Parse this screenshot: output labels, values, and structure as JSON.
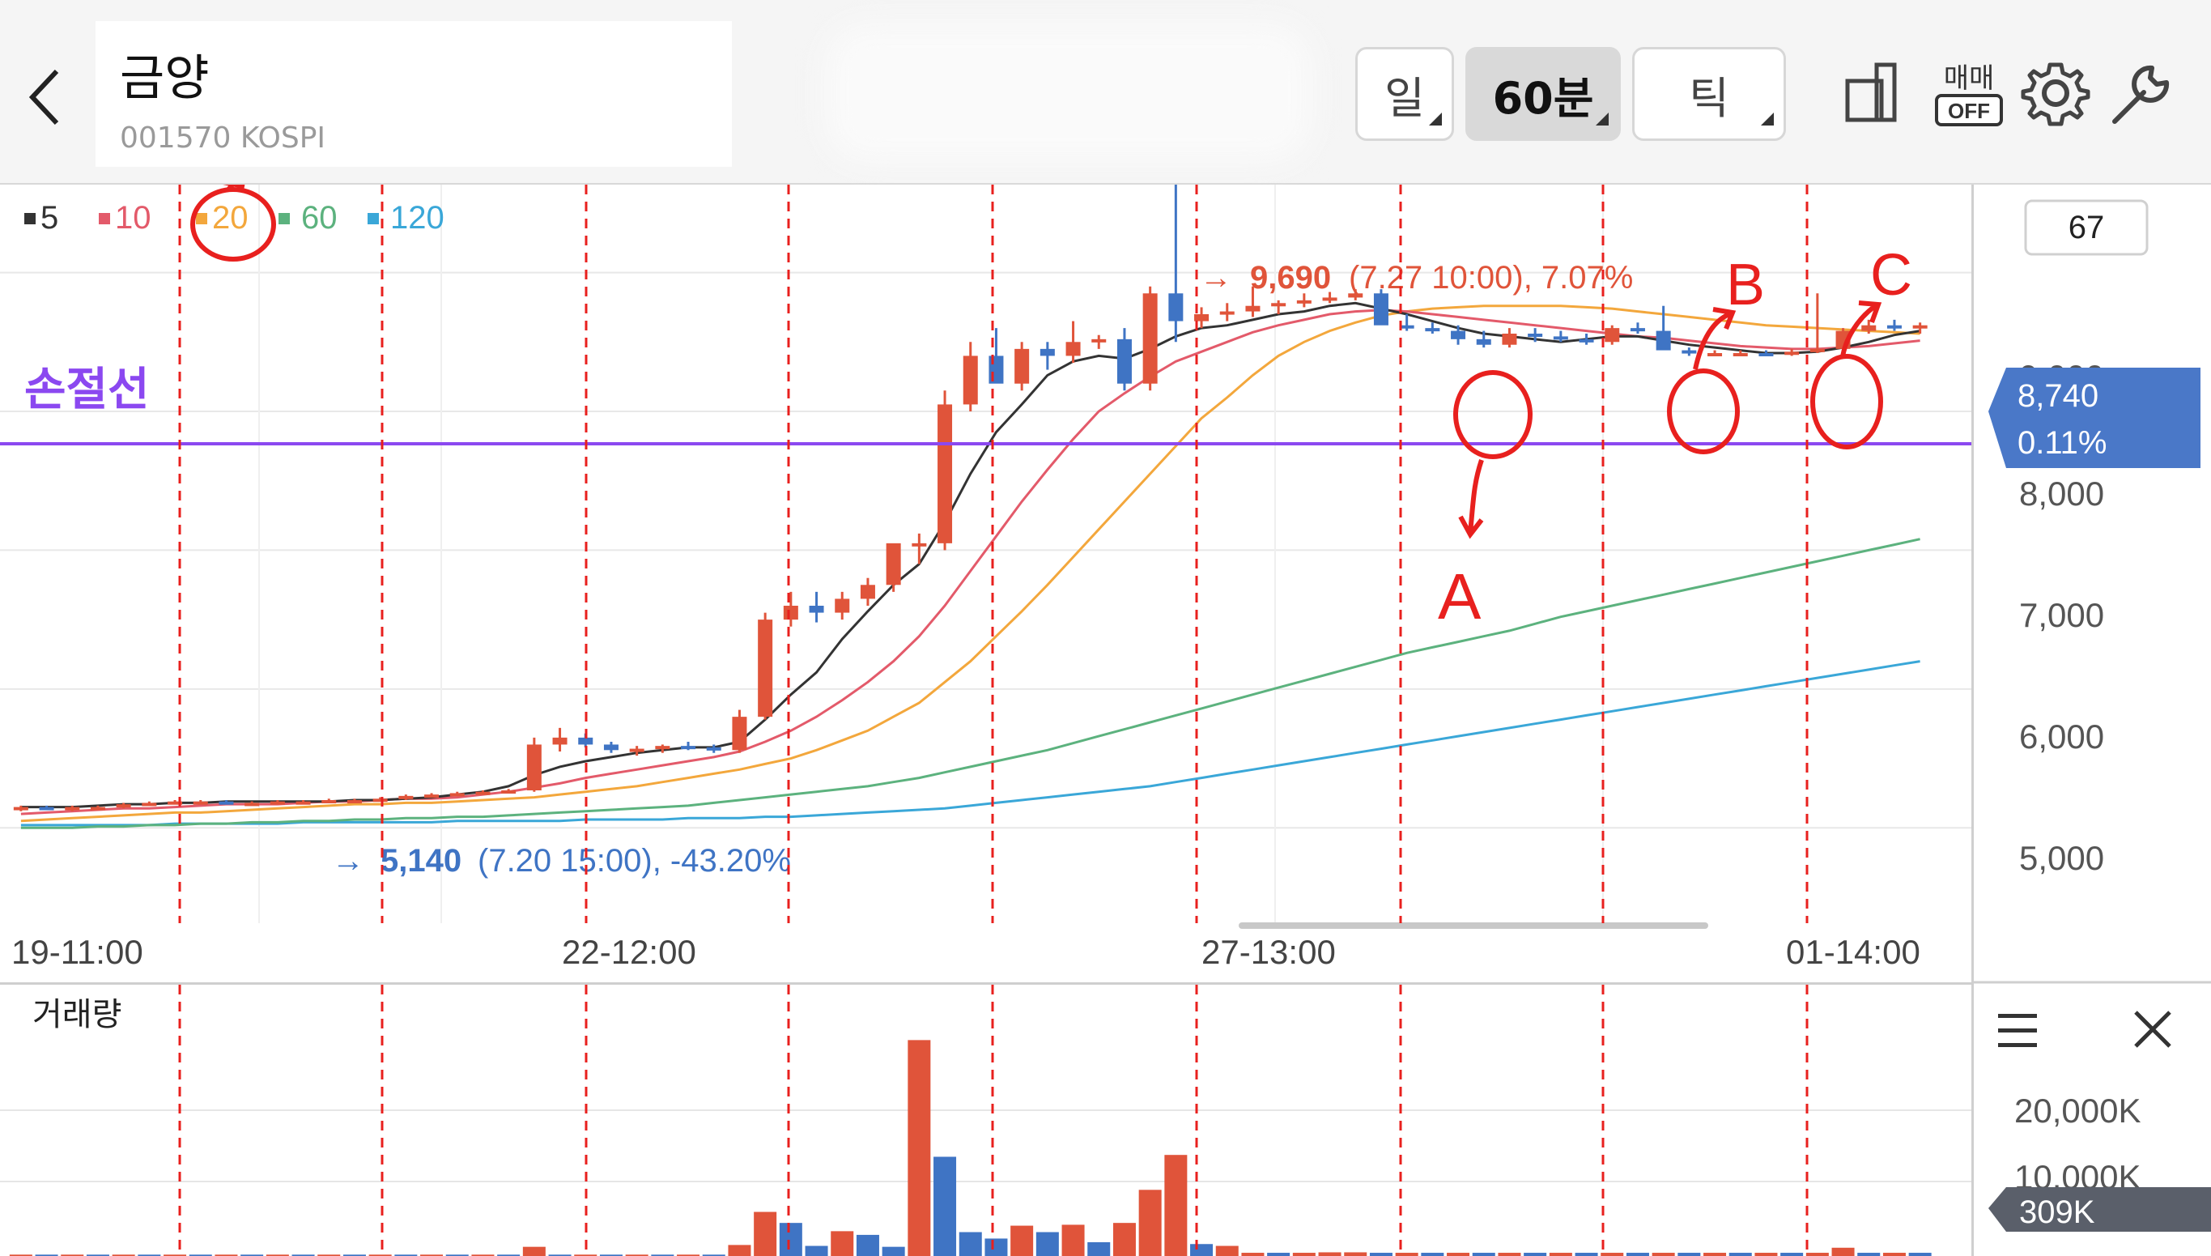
{
  "header": {
    "stock_name": "금양",
    "stock_code": "001570 KOSPI",
    "periods": [
      {
        "label": "일",
        "active": false
      },
      {
        "label": "60분",
        "active": true
      },
      {
        "label": "틱",
        "active": false
      }
    ],
    "trade_toggle_label": "매매",
    "trade_toggle_state": "OFF"
  },
  "legend": [
    {
      "label": "5",
      "color": "#333333"
    },
    {
      "label": "10",
      "color": "#e35a6a"
    },
    {
      "label": "20",
      "color": "#f3a73c"
    },
    {
      "label": "60",
      "color": "#5cb27e"
    },
    {
      "label": "120",
      "color": "#3aa7d8"
    }
  ],
  "annotations": {
    "stop_line_label": "손절선",
    "markers": [
      "A",
      "B",
      "C"
    ]
  },
  "price_high_label": {
    "value": "9,690",
    "detail": "(7.27 10:00), 7.07%"
  },
  "price_low_label": {
    "value": "5,140",
    "detail": "(7.20 15:00), -43.20%"
  },
  "price_axis": {
    "top_box": "67",
    "ticks": [
      "9,000",
      "8,000",
      "7,000",
      "6,000",
      "5,000"
    ],
    "current_price": "8,740",
    "current_change": "0.11%"
  },
  "time_axis": [
    "19-11:00",
    "22-12:00",
    "27-13:00",
    "01-14:00"
  ],
  "volume": {
    "title": "거래량",
    "ticks": [
      "20,000K",
      "10,000K"
    ],
    "current": "309K"
  },
  "colors": {
    "up": "#e0543a",
    "down": "#3f74c4",
    "stop_line": "#8b48f0",
    "annotation": "#e8201e"
  },
  "chart_data": {
    "type": "candlestick",
    "price_ylim": [
      4500,
      9400
    ],
    "candles": [
      [
        5140,
        5160,
        5120,
        5150
      ],
      [
        5150,
        5160,
        5130,
        5140
      ],
      [
        5140,
        5160,
        5120,
        5150
      ],
      [
        5150,
        5160,
        5140,
        5150
      ],
      [
        5150,
        5180,
        5140,
        5170
      ],
      [
        5170,
        5190,
        5160,
        5180
      ],
      [
        5180,
        5200,
        5170,
        5190
      ],
      [
        5190,
        5200,
        5180,
        5190
      ],
      [
        5190,
        5200,
        5170,
        5180
      ],
      [
        5180,
        5190,
        5170,
        5180
      ],
      [
        5180,
        5200,
        5170,
        5190
      ],
      [
        5190,
        5200,
        5180,
        5190
      ],
      [
        5190,
        5210,
        5180,
        5200
      ],
      [
        5200,
        5210,
        5190,
        5200
      ],
      [
        5200,
        5220,
        5190,
        5210
      ],
      [
        5210,
        5240,
        5200,
        5230
      ],
      [
        5230,
        5250,
        5220,
        5240
      ],
      [
        5240,
        5260,
        5230,
        5250
      ],
      [
        5250,
        5270,
        5240,
        5260
      ],
      [
        5260,
        5280,
        5250,
        5270
      ],
      [
        5270,
        5650,
        5260,
        5600
      ],
      [
        5600,
        5720,
        5550,
        5650
      ],
      [
        5650,
        5680,
        5580,
        5600
      ],
      [
        5600,
        5620,
        5540,
        5560
      ],
      [
        5560,
        5590,
        5520,
        5570
      ],
      [
        5570,
        5600,
        5540,
        5590
      ],
      [
        5590,
        5620,
        5560,
        5580
      ],
      [
        5580,
        5600,
        5540,
        5560
      ],
      [
        5560,
        5850,
        5540,
        5800
      ],
      [
        5800,
        6550,
        5780,
        6500
      ],
      [
        6500,
        6700,
        6450,
        6600
      ],
      [
        6600,
        6700,
        6480,
        6550
      ],
      [
        6550,
        6700,
        6500,
        6650
      ],
      [
        6650,
        6800,
        6600,
        6750
      ],
      [
        6750,
        6950,
        6700,
        7050
      ],
      [
        7050,
        7120,
        6900,
        7050
      ],
      [
        7050,
        8150,
        7000,
        8050
      ],
      [
        8050,
        8500,
        8000,
        8400
      ],
      [
        8400,
        8600,
        8300,
        8200
      ],
      [
        8200,
        8500,
        8150,
        8450
      ],
      [
        8450,
        8500,
        8300,
        8400
      ],
      [
        8400,
        8650,
        8350,
        8500
      ],
      [
        8500,
        8550,
        8450,
        8520
      ],
      [
        8520,
        8600,
        8150,
        8200
      ],
      [
        8200,
        8900,
        8150,
        8850
      ],
      [
        8850,
        9690,
        8500,
        8650
      ],
      [
        8650,
        8750,
        8600,
        8700
      ],
      [
        8700,
        8780,
        8650,
        8720
      ],
      [
        8720,
        8900,
        8680,
        8760
      ],
      [
        8760,
        8800,
        8700,
        8780
      ],
      [
        8780,
        8850,
        8750,
        8800
      ],
      [
        8800,
        8860,
        8780,
        8820
      ],
      [
        8820,
        8880,
        8800,
        8850
      ],
      [
        8850,
        8880,
        8780,
        8620
      ],
      [
        8620,
        8700,
        8580,
        8600
      ],
      [
        8600,
        8640,
        8560,
        8580
      ],
      [
        8580,
        8620,
        8480,
        8520
      ],
      [
        8520,
        8580,
        8460,
        8480
      ],
      [
        8480,
        8600,
        8460,
        8560
      ],
      [
        8560,
        8600,
        8500,
        8540
      ],
      [
        8540,
        8580,
        8500,
        8520
      ],
      [
        8520,
        8560,
        8480,
        8500
      ],
      [
        8500,
        8620,
        8480,
        8600
      ],
      [
        8600,
        8640,
        8560,
        8580
      ],
      [
        8580,
        8760,
        8460,
        8440
      ],
      [
        8440,
        8460,
        8400,
        8420
      ],
      [
        8420,
        8440,
        8400,
        8420
      ],
      [
        8420,
        8440,
        8400,
        8420
      ],
      [
        8420,
        8440,
        8400,
        8410
      ],
      [
        8410,
        8450,
        8400,
        8430
      ],
      [
        8430,
        8850,
        8420,
        8450
      ],
      [
        8450,
        8600,
        8440,
        8580
      ],
      [
        8580,
        8660,
        8560,
        8620
      ],
      [
        8620,
        8660,
        8580,
        8600
      ],
      [
        8600,
        8640,
        8560,
        8620
      ]
    ],
    "ma5": [
      5150,
      5150,
      5150,
      5160,
      5170,
      5170,
      5180,
      5180,
      5190,
      5190,
      5190,
      5190,
      5190,
      5200,
      5200,
      5210,
      5220,
      5240,
      5260,
      5300,
      5380,
      5440,
      5480,
      5510,
      5540,
      5560,
      5580,
      5580,
      5620,
      5780,
      5960,
      6120,
      6360,
      6560,
      6750,
      6900,
      7200,
      7550,
      7850,
      8050,
      8260,
      8360,
      8400,
      8380,
      8450,
      8540,
      8600,
      8620,
      8660,
      8700,
      8720,
      8760,
      8780,
      8740,
      8700,
      8650,
      8600,
      8560,
      8540,
      8520,
      8500,
      8520,
      8540,
      8540,
      8510,
      8480,
      8460,
      8440,
      8420,
      8420,
      8430,
      8460,
      8500,
      8550,
      8580
    ],
    "ma10": [
      5100,
      5110,
      5120,
      5130,
      5140,
      5140,
      5150,
      5160,
      5170,
      5170,
      5170,
      5180,
      5190,
      5190,
      5200,
      5210,
      5210,
      5220,
      5240,
      5260,
      5290,
      5320,
      5360,
      5390,
      5420,
      5450,
      5480,
      5510,
      5550,
      5620,
      5700,
      5800,
      5920,
      6050,
      6200,
      6380,
      6600,
      6850,
      7100,
      7350,
      7580,
      7800,
      8000,
      8130,
      8250,
      8360,
      8430,
      8500,
      8570,
      8620,
      8660,
      8700,
      8720,
      8730,
      8720,
      8700,
      8680,
      8660,
      8640,
      8620,
      8600,
      8580,
      8560,
      8540,
      8530,
      8510,
      8490,
      8470,
      8460,
      8450,
      8450,
      8460,
      8470,
      8490,
      8510
    ],
    "ma20": [
      5050,
      5060,
      5070,
      5080,
      5090,
      5100,
      5110,
      5110,
      5120,
      5130,
      5140,
      5150,
      5160,
      5170,
      5170,
      5180,
      5180,
      5190,
      5200,
      5210,
      5220,
      5240,
      5260,
      5280,
      5300,
      5330,
      5360,
      5390,
      5420,
      5460,
      5500,
      5560,
      5630,
      5700,
      5800,
      5900,
      6050,
      6200,
      6380,
      6560,
      6750,
      6950,
      7150,
      7350,
      7550,
      7750,
      7950,
      8100,
      8260,
      8400,
      8500,
      8580,
      8640,
      8690,
      8720,
      8740,
      8750,
      8760,
      8760,
      8760,
      8760,
      8750,
      8740,
      8720,
      8700,
      8680,
      8660,
      8640,
      8620,
      8610,
      8600,
      8590,
      8580,
      8570,
      8560
    ],
    "ma60": [
      5000,
      5000,
      5000,
      5010,
      5010,
      5020,
      5020,
      5030,
      5030,
      5040,
      5040,
      5050,
      5050,
      5060,
      5060,
      5070,
      5070,
      5080,
      5080,
      5090,
      5100,
      5110,
      5120,
      5130,
      5140,
      5150,
      5160,
      5180,
      5200,
      5220,
      5240,
      5260,
      5280,
      5300,
      5330,
      5360,
      5400,
      5440,
      5480,
      5520,
      5560,
      5610,
      5660,
      5710,
      5760,
      5810,
      5860,
      5910,
      5960,
      6010,
      6060,
      6110,
      6160,
      6210,
      6260,
      6300,
      6340,
      6380,
      6420,
      6470,
      6520,
      6560,
      6600,
      6640,
      6680,
      6720,
      6760,
      6800,
      6840,
      6880,
      6920,
      6960,
      7000,
      7040,
      7080
    ],
    "ma120": [
      5020,
      5020,
      5020,
      5020,
      5020,
      5020,
      5030,
      5030,
      5030,
      5030,
      5030,
      5040,
      5040,
      5040,
      5040,
      5040,
      5040,
      5050,
      5050,
      5050,
      5050,
      5050,
      5060,
      5060,
      5060,
      5060,
      5070,
      5070,
      5070,
      5080,
      5080,
      5090,
      5100,
      5110,
      5120,
      5130,
      5140,
      5160,
      5180,
      5200,
      5220,
      5240,
      5260,
      5280,
      5300,
      5330,
      5360,
      5390,
      5420,
      5450,
      5480,
      5510,
      5540,
      5570,
      5600,
      5630,
      5660,
      5690,
      5720,
      5750,
      5780,
      5810,
      5840,
      5870,
      5900,
      5930,
      5960,
      5990,
      6020,
      6050,
      6080,
      6110,
      6140,
      6170,
      6200
    ],
    "volume_ylim": [
      0,
      26000
    ],
    "volume": [
      [
        150,
        0
      ],
      [
        150,
        1
      ],
      [
        150,
        0
      ],
      [
        150,
        1
      ],
      [
        150,
        0
      ],
      [
        150,
        1
      ],
      [
        150,
        0
      ],
      [
        150,
        1
      ],
      [
        150,
        0
      ],
      [
        150,
        1
      ],
      [
        150,
        0
      ],
      [
        150,
        1
      ],
      [
        150,
        0
      ],
      [
        150,
        1
      ],
      [
        150,
        0
      ],
      [
        150,
        1
      ],
      [
        150,
        0
      ],
      [
        150,
        1
      ],
      [
        150,
        0
      ],
      [
        150,
        1
      ],
      [
        1000,
        0
      ],
      [
        150,
        1
      ],
      [
        150,
        0
      ],
      [
        150,
        1
      ],
      [
        150,
        0
      ],
      [
        150,
        1
      ],
      [
        150,
        0
      ],
      [
        150,
        1
      ],
      [
        1200,
        0
      ],
      [
        4800,
        0
      ],
      [
        3600,
        1
      ],
      [
        1100,
        1
      ],
      [
        2700,
        0
      ],
      [
        2300,
        1
      ],
      [
        1000,
        1
      ],
      [
        23500,
        0
      ],
      [
        10800,
        1
      ],
      [
        2600,
        1
      ],
      [
        1900,
        1
      ],
      [
        3300,
        0
      ],
      [
        2600,
        1
      ],
      [
        3400,
        0
      ],
      [
        1500,
        1
      ],
      [
        3600,
        0
      ],
      [
        7200,
        0
      ],
      [
        11000,
        0
      ],
      [
        1300,
        1
      ],
      [
        1100,
        0
      ],
      [
        350,
        0
      ],
      [
        350,
        1
      ],
      [
        350,
        0
      ],
      [
        400,
        0
      ],
      [
        400,
        0
      ],
      [
        350,
        1
      ],
      [
        350,
        0
      ],
      [
        350,
        1
      ],
      [
        350,
        0
      ],
      [
        350,
        1
      ],
      [
        350,
        0
      ],
      [
        350,
        1
      ],
      [
        350,
        0
      ],
      [
        350,
        1
      ],
      [
        350,
        0
      ],
      [
        350,
        1
      ],
      [
        350,
        0
      ],
      [
        350,
        1
      ],
      [
        350,
        0
      ],
      [
        350,
        1
      ],
      [
        350,
        0
      ],
      [
        350,
        1
      ],
      [
        350,
        0
      ],
      [
        900,
        0
      ],
      [
        350,
        1
      ],
      [
        350,
        0
      ],
      [
        350,
        1
      ]
    ]
  }
}
